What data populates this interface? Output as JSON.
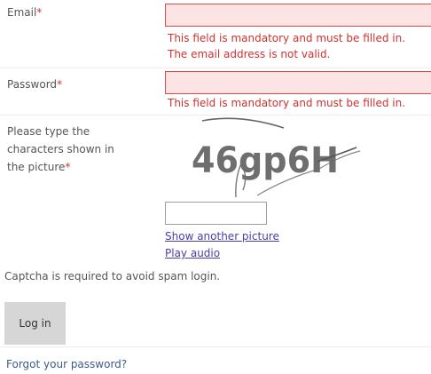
{
  "form": {
    "required_marker": "*",
    "email": {
      "label": "Email",
      "value": "",
      "errors": [
        "This field is mandatory and must be filled in.",
        "The email address is not valid."
      ]
    },
    "password": {
      "label": "Password",
      "value": "",
      "errors": [
        "This field is mandatory and must be filled in."
      ]
    },
    "captcha": {
      "label_lines": [
        "Please type the",
        "characters shown in",
        "the picture"
      ],
      "image_text": "46gp6H",
      "value": "",
      "show_another_link": "Show another picture",
      "play_audio_link": "Play audio",
      "note": "Captcha is required to avoid spam login."
    },
    "login_button": "Log in",
    "forgot_link": "Forgot your password?"
  },
  "colors": {
    "error": "#d2312f",
    "field_error_bg": "#fde4e4",
    "field_error_border": "#dd4b4b",
    "link": "#4a3ea8",
    "button_bg": "#d6d6d6"
  }
}
